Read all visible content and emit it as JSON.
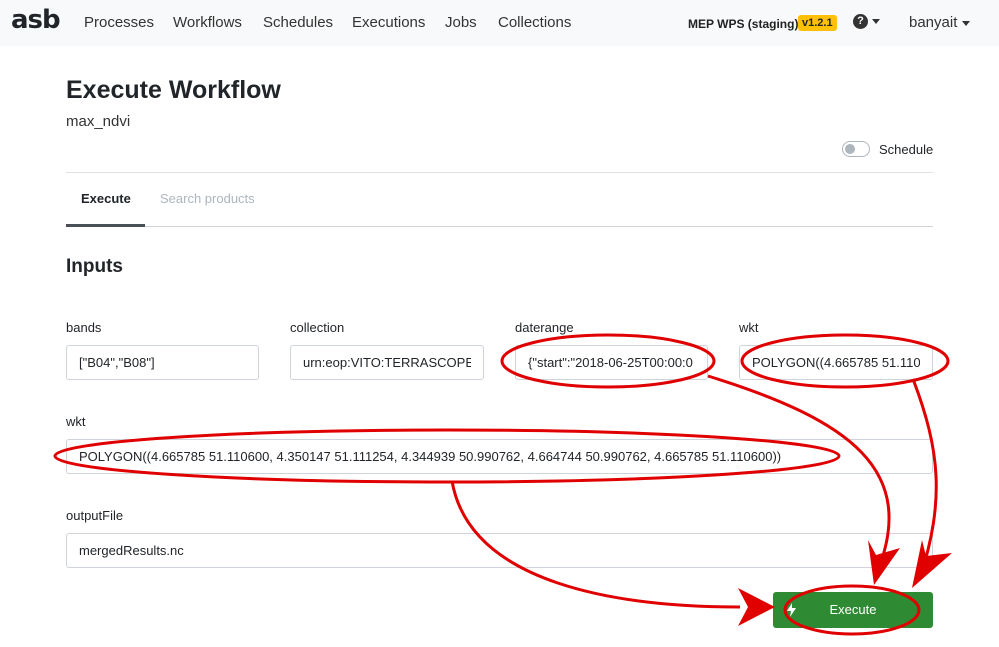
{
  "nav": {
    "brand": "asb",
    "links": [
      "Processes",
      "Workflows",
      "Schedules",
      "Executions",
      "Jobs",
      "Collections"
    ],
    "environment": "MEP WPS (staging)",
    "version": "v1.2.1",
    "help_icon": "question-circle-icon",
    "user": "banyait"
  },
  "header": {
    "title": "Execute Workflow",
    "subtitle": "max_ndvi",
    "schedule_label": "Schedule",
    "schedule_enabled": false
  },
  "tabs": [
    {
      "label": "Execute",
      "active": true
    },
    {
      "label": "Search products",
      "active": false
    }
  ],
  "inputs": {
    "section_title": "Inputs",
    "bands": {
      "label": "bands",
      "value": "[\"B04\",\"B08\"]"
    },
    "collection": {
      "label": "collection",
      "value": "urn:eop:VITO:TERRASCOPE_"
    },
    "daterange": {
      "label": "daterange",
      "value": "{\"start\":\"2018-06-25T00:00:0"
    },
    "wkt_small": {
      "label": "wkt",
      "value": "POLYGON((4.665785 51.110"
    },
    "wkt_full": {
      "label": "wkt",
      "value": "POLYGON((4.665785 51.110600, 4.350147 51.111254, 4.344939 50.990762, 4.664744 50.990762, 4.665785 51.110600))"
    },
    "output_file": {
      "label": "outputFile",
      "value": "mergedResults.nc"
    }
  },
  "execute_button": {
    "label": "Execute",
    "icon": "bolt-icon"
  },
  "colors": {
    "navbar_bg": "#f8f9fa",
    "version_badge": "#ffc107",
    "execute_green": "#2e8b34",
    "annotation_red": "#e00000"
  }
}
